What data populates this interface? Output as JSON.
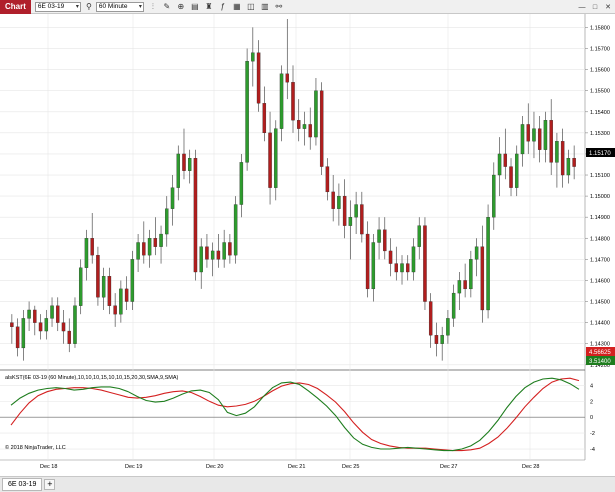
{
  "toolbar": {
    "title": "Chart",
    "instrument": "6E 03-19",
    "interval": "60 Minute",
    "icons": [
      "bar-type-icon",
      "pencil-icon",
      "zoom-icon",
      "properties-icon",
      "strategy-icon",
      "indicator-icon",
      "data-box-icon",
      "chart-trader-icon",
      "template-icon",
      "attach-icon"
    ]
  },
  "price_axis": {
    "ticks": [
      "1.15800",
      "1.15700",
      "1.15600",
      "1.15500",
      "1.15400",
      "1.15300",
      "1.15200",
      "1.15100",
      "1.15000",
      "1.14900",
      "1.14800",
      "1.14700",
      "1.14600",
      "1.14500",
      "1.14400",
      "1.14300",
      "1.14200"
    ],
    "last_price": "1.15170"
  },
  "indicator": {
    "label": "alsKST(6E 03-19 (60 Minute),10,10,10,15,10,10,15,20,30,SMA,9,SMA)",
    "ticks": [
      "4",
      "2",
      "0",
      "-2",
      "-4"
    ],
    "badge_red": "4.56625",
    "badge_green": "3.51400",
    "colors": {
      "kst": "#1e7d1e",
      "signal": "#d42020"
    }
  },
  "time_axis": [
    "Dec 18",
    "Dec 19",
    "Dec 20",
    "Dec 21",
    "Dec 25",
    "Dec 27",
    "Dec 28"
  ],
  "copyright": "© 2018 NinjaTrader, LLC",
  "bottom_tab": "6E 03-19",
  "chart_data": {
    "type": "candlestick",
    "instrument": "6E 03-19",
    "interval": "60 Minute",
    "ylim": [
      1.1418,
      1.1584
    ],
    "up_color": "#2e9b2e",
    "down_color": "#b01e1e",
    "candles": [
      [
        1.144,
        1.1444,
        1.143,
        1.1438
      ],
      [
        1.1438,
        1.1442,
        1.1424,
        1.1428
      ],
      [
        1.1428,
        1.1446,
        1.1422,
        1.1442
      ],
      [
        1.1442,
        1.145,
        1.1436,
        1.1446
      ],
      [
        1.1446,
        1.1448,
        1.1434,
        1.144
      ],
      [
        1.144,
        1.1444,
        1.1432,
        1.1436
      ],
      [
        1.1436,
        1.1446,
        1.1432,
        1.1442
      ],
      [
        1.1442,
        1.1452,
        1.1438,
        1.1448
      ],
      [
        1.1448,
        1.1452,
        1.1436,
        1.144
      ],
      [
        1.144,
        1.1446,
        1.143,
        1.1436
      ],
      [
        1.1436,
        1.1442,
        1.1426,
        1.143
      ],
      [
        1.143,
        1.1452,
        1.1428,
        1.1448
      ],
      [
        1.1448,
        1.147,
        1.1444,
        1.1466
      ],
      [
        1.1466,
        1.1484,
        1.146,
        1.148
      ],
      [
        1.148,
        1.1492,
        1.1468,
        1.1472
      ],
      [
        1.1472,
        1.1476,
        1.1448,
        1.1452
      ],
      [
        1.1452,
        1.1466,
        1.1446,
        1.1462
      ],
      [
        1.1462,
        1.1466,
        1.1444,
        1.1448
      ],
      [
        1.1448,
        1.1454,
        1.1438,
        1.1444
      ],
      [
        1.1444,
        1.146,
        1.144,
        1.1456
      ],
      [
        1.1456,
        1.1462,
        1.1446,
        1.145
      ],
      [
        1.145,
        1.1474,
        1.1446,
        1.147
      ],
      [
        1.147,
        1.1482,
        1.1464,
        1.1478
      ],
      [
        1.1478,
        1.1488,
        1.1468,
        1.1472
      ],
      [
        1.1472,
        1.1484,
        1.1466,
        1.148
      ],
      [
        1.148,
        1.149,
        1.1472,
        1.1476
      ],
      [
        1.1476,
        1.1486,
        1.1468,
        1.1482
      ],
      [
        1.1482,
        1.15,
        1.1476,
        1.1494
      ],
      [
        1.1494,
        1.151,
        1.1486,
        1.1504
      ],
      [
        1.1504,
        1.1524,
        1.1498,
        1.152
      ],
      [
        1.152,
        1.1532,
        1.1508,
        1.1512
      ],
      [
        1.1512,
        1.1522,
        1.1506,
        1.1518
      ],
      [
        1.1518,
        1.1522,
        1.146,
        1.1464
      ],
      [
        1.1464,
        1.148,
        1.1456,
        1.1476
      ],
      [
        1.1476,
        1.1482,
        1.1466,
        1.147
      ],
      [
        1.147,
        1.1478,
        1.1462,
        1.1474
      ],
      [
        1.1474,
        1.1482,
        1.1466,
        1.147
      ],
      [
        1.147,
        1.1484,
        1.1466,
        1.1478
      ],
      [
        1.1478,
        1.1482,
        1.1468,
        1.1472
      ],
      [
        1.1472,
        1.15,
        1.1468,
        1.1496
      ],
      [
        1.1496,
        1.152,
        1.149,
        1.1516
      ],
      [
        1.1516,
        1.157,
        1.1512,
        1.1564
      ],
      [
        1.1564,
        1.158,
        1.1552,
        1.1568
      ],
      [
        1.1568,
        1.1574,
        1.154,
        1.1544
      ],
      [
        1.1544,
        1.1552,
        1.1526,
        1.153
      ],
      [
        1.153,
        1.154,
        1.1496,
        1.1504
      ],
      [
        1.1504,
        1.1536,
        1.1498,
        1.1532
      ],
      [
        1.1532,
        1.1562,
        1.1526,
        1.1558
      ],
      [
        1.1558,
        1.1584,
        1.1546,
        1.1554
      ],
      [
        1.1554,
        1.1562,
        1.153,
        1.1536
      ],
      [
        1.1536,
        1.1546,
        1.1526,
        1.1532
      ],
      [
        1.1532,
        1.154,
        1.1524,
        1.1534
      ],
      [
        1.1534,
        1.1542,
        1.1522,
        1.1528
      ],
      [
        1.1528,
        1.1556,
        1.1524,
        1.155
      ],
      [
        1.155,
        1.1554,
        1.151,
        1.1514
      ],
      [
        1.1514,
        1.1518,
        1.1498,
        1.1502
      ],
      [
        1.1502,
        1.151,
        1.1488,
        1.1494
      ],
      [
        1.1494,
        1.1506,
        1.1486,
        1.15
      ],
      [
        1.15,
        1.1508,
        1.148,
        1.1486
      ],
      [
        1.1486,
        1.1498,
        1.147,
        1.149
      ],
      [
        1.149,
        1.1502,
        1.1482,
        1.1496
      ],
      [
        1.1496,
        1.1502,
        1.1478,
        1.1482
      ],
      [
        1.1482,
        1.1488,
        1.1452,
        1.1456
      ],
      [
        1.1456,
        1.1482,
        1.145,
        1.1478
      ],
      [
        1.1478,
        1.149,
        1.147,
        1.1484
      ],
      [
        1.1484,
        1.149,
        1.147,
        1.1474
      ],
      [
        1.1474,
        1.148,
        1.1462,
        1.1468
      ],
      [
        1.1468,
        1.1476,
        1.146,
        1.1464
      ],
      [
        1.1464,
        1.1472,
        1.1458,
        1.1468
      ],
      [
        1.1468,
        1.1472,
        1.146,
        1.1464
      ],
      [
        1.1464,
        1.148,
        1.146,
        1.1476
      ],
      [
        1.1476,
        1.149,
        1.147,
        1.1486
      ],
      [
        1.1486,
        1.149,
        1.1446,
        1.145
      ],
      [
        1.145,
        1.1454,
        1.1428,
        1.1434
      ],
      [
        1.1434,
        1.144,
        1.1424,
        1.143
      ],
      [
        1.143,
        1.1438,
        1.1422,
        1.1434
      ],
      [
        1.1434,
        1.1446,
        1.143,
        1.1442
      ],
      [
        1.1442,
        1.1458,
        1.1438,
        1.1454
      ],
      [
        1.1454,
        1.1464,
        1.1446,
        1.146
      ],
      [
        1.146,
        1.1468,
        1.1452,
        1.1456
      ],
      [
        1.1456,
        1.1474,
        1.1452,
        1.147
      ],
      [
        1.147,
        1.148,
        1.1462,
        1.1476
      ],
      [
        1.1476,
        1.1486,
        1.144,
        1.1446
      ],
      [
        1.1446,
        1.1496,
        1.1442,
        1.149
      ],
      [
        1.149,
        1.1516,
        1.1484,
        1.151
      ],
      [
        1.151,
        1.1528,
        1.15,
        1.152
      ],
      [
        1.152,
        1.1532,
        1.1508,
        1.1514
      ],
      [
        1.1514,
        1.1518,
        1.15,
        1.1504
      ],
      [
        1.1504,
        1.1524,
        1.15,
        1.152
      ],
      [
        1.152,
        1.1538,
        1.1514,
        1.1534
      ],
      [
        1.1534,
        1.1544,
        1.152,
        1.1526
      ],
      [
        1.1526,
        1.154,
        1.1518,
        1.1532
      ],
      [
        1.1532,
        1.1538,
        1.1516,
        1.1522
      ],
      [
        1.1522,
        1.154,
        1.1516,
        1.1536
      ],
      [
        1.1536,
        1.1546,
        1.151,
        1.1516
      ],
      [
        1.1516,
        1.153,
        1.1504,
        1.1526
      ],
      [
        1.1526,
        1.1532,
        1.1504,
        1.151
      ],
      [
        1.151,
        1.1522,
        1.1506,
        1.1518
      ],
      [
        1.1518,
        1.1524,
        1.1508,
        1.1514
      ]
    ],
    "kst": [
      1.5,
      2.4,
      3.0,
      3.4,
      3.6,
      3.7,
      3.6,
      3.4,
      3.5,
      3.7,
      3.8,
      3.8,
      3.6,
      3.2,
      2.6,
      2.1,
      1.9,
      2.0,
      2.4,
      2.9,
      3.3,
      3.4,
      3.1,
      2.2,
      0.6,
      0.2,
      0.5,
      1.3,
      2.6,
      3.7,
      4.3,
      4.4,
      4.1,
      3.3,
      2.4,
      1.4,
      0.2,
      -1.3,
      -2.6,
      -3.4,
      -3.8,
      -4.0,
      -4.0,
      -3.9,
      -3.8,
      -3.9,
      -4.0,
      -4.1,
      -4.2,
      -4.2,
      -4.0,
      -3.6,
      -2.9,
      -1.8,
      -0.4,
      1.2,
      2.6,
      3.7,
      4.4,
      4.8,
      4.9,
      4.7,
      4.2,
      3.5
    ],
    "signal": [
      -1.0,
      0.5,
      1.8,
      2.7,
      3.2,
      3.5,
      3.6,
      3.7,
      3.7,
      3.6,
      3.4,
      3.1,
      2.8,
      2.5,
      2.4,
      2.5,
      2.7,
      3.0,
      3.2,
      3.3,
      3.1,
      2.6,
      2.0,
      1.5,
      1.3,
      1.4,
      1.6,
      2.0,
      2.6,
      3.3,
      3.9,
      4.2,
      4.3,
      4.1,
      3.6,
      2.8,
      1.9,
      0.7,
      -0.7,
      -1.9,
      -2.8,
      -3.3,
      -3.6,
      -3.8,
      -3.9,
      -3.9,
      -3.9,
      -4.0,
      -4.1,
      -4.2,
      -4.2,
      -4.1,
      -3.9,
      -3.3,
      -2.5,
      -1.4,
      -0.1,
      1.3,
      2.5,
      3.6,
      4.4,
      4.8,
      4.9,
      4.6
    ],
    "indicator_ylim": [
      -5,
      5.8
    ],
    "zero_line": 0
  }
}
